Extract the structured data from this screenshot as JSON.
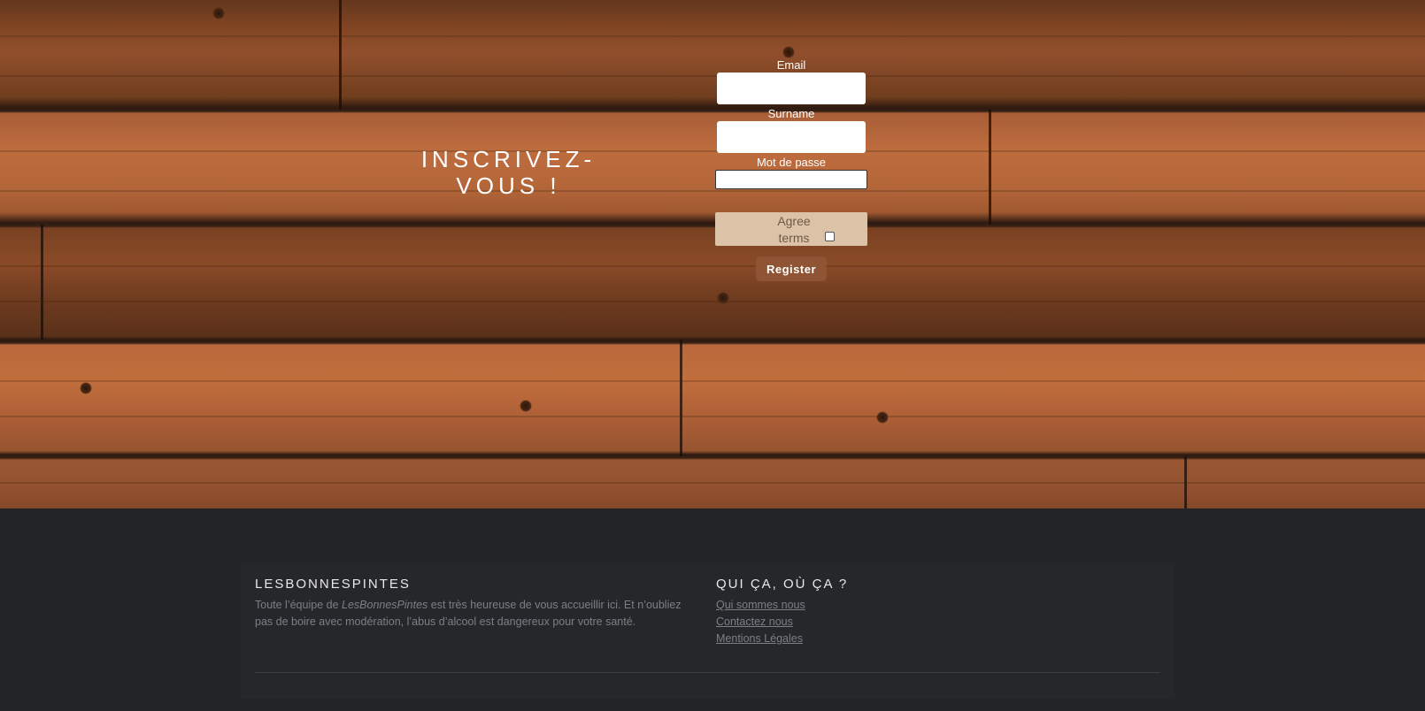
{
  "hero": {
    "title": "INSCRIVEZ-VOUS !"
  },
  "form": {
    "email_label": "Email",
    "email_value": "",
    "surname_label": "Surname",
    "surname_value": "",
    "password_label": "Mot de passe",
    "password_value": "",
    "agree_label": "Agree terms",
    "agree_checked": false,
    "register_label": "Register"
  },
  "footer": {
    "left": {
      "heading": "LESBONNESPINTES",
      "text_before": "Toute l’équipe de ",
      "text_brand": "LesBonnesPintes",
      "text_after": " est très heureuse de vous accueillir ici. Et n’oubliez pas de boire avec modération, l’abus d’alcool est dangereux pour votre santé."
    },
    "right": {
      "heading": "QUI ÇA, OÙ ÇA ?",
      "links": [
        "Qui sommes nous",
        "Contactez nous",
        "Mentions Légales"
      ]
    }
  },
  "colors": {
    "footer_bg": "#222427",
    "register_button": "#8e5434",
    "agree_box": "#dcc2a6"
  }
}
